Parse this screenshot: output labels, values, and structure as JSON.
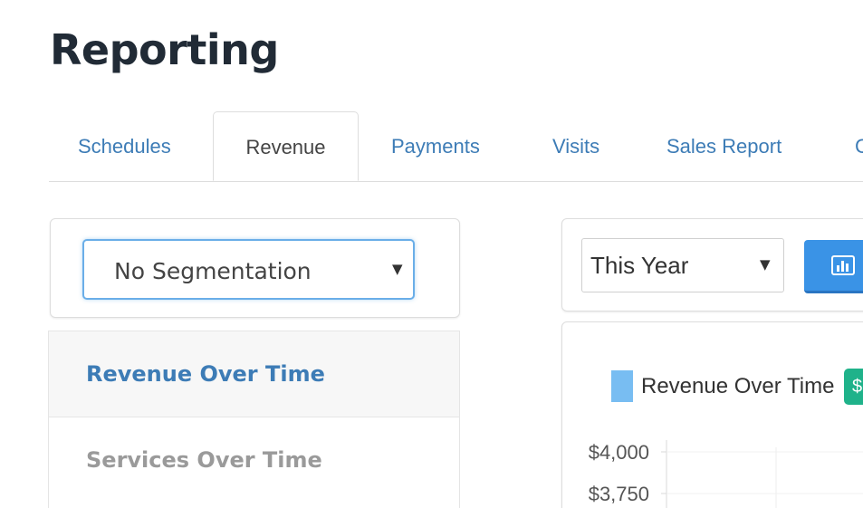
{
  "page": {
    "title": "Reporting"
  },
  "tabs": [
    {
      "label": "Schedules",
      "active": false
    },
    {
      "label": "Revenue",
      "active": true
    },
    {
      "label": "Payments",
      "active": false
    },
    {
      "label": "Visits",
      "active": false
    },
    {
      "label": "Sales Report",
      "active": false
    },
    {
      "label": "C",
      "active": false
    }
  ],
  "segmentation": {
    "selected": "No Segmentation",
    "caret_icon": "caret-down-icon"
  },
  "reports": [
    {
      "label": "Revenue Over Time",
      "active": true
    },
    {
      "label": "Services Over Time",
      "active": false
    }
  ],
  "period": {
    "selected": "This Year",
    "caret_icon": "caret-down-icon"
  },
  "chart_button": {
    "icon": "bar-chart-icon"
  },
  "colors": {
    "link": "#3d7cb6",
    "active_tab_text": "#444444",
    "primary_button": "#3a93e6",
    "legend_swatch": "#78bdf2",
    "badge": "#1fb28a"
  },
  "chart_data": {
    "type": "bar",
    "title": "",
    "series": [
      {
        "name": "Revenue Over Time",
        "values": []
      }
    ],
    "legend_badge": "$",
    "y_ticks": [
      "$4,000",
      "$3,750"
    ],
    "grid": true,
    "legend_placement": "top"
  }
}
